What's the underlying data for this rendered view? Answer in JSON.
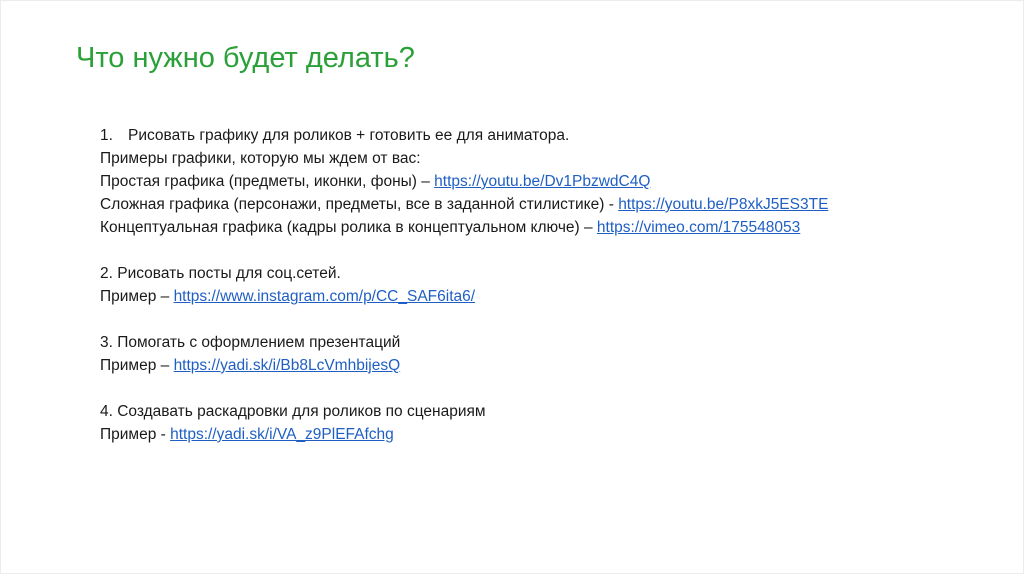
{
  "theme": {
    "title_color": "#2aa038",
    "link_color": "#1f5fc4"
  },
  "title": "Что нужно будет делать?",
  "items": [
    {
      "heading_number": "1.",
      "heading_text": "Рисовать графику для роликов + готовить ее для аниматора.",
      "subheading": "Примеры графики, которую мы ждем от вас:",
      "examples": [
        {
          "text": "Простая графика (предметы, иконки, фоны) – ",
          "link": "https://youtu.be/Dv1PbzwdC4Q"
        },
        {
          "text": "Сложная графика (персонажи, предметы, все в заданной стилистике) - ",
          "link": "https://youtu.be/P8xkJ5ES3TE"
        },
        {
          "text": "Концептуальная графика (кадры ролика в концептуальном ключе) – ",
          "link": "https://vimeo.com/175548053"
        }
      ]
    },
    {
      "heading": "2. Рисовать посты для соц.сетей.",
      "example_text": "Пример – ",
      "example_link": "https://www.instagram.com/p/CC_SAF6ita6/"
    },
    {
      "heading": "3. Помогать с оформлением презентаций",
      "example_text": "Пример – ",
      "example_link": "https://yadi.sk/i/Bb8LcVmhbijesQ"
    },
    {
      "heading": "4. Создавать раскадровки для роликов по сценариям",
      "example_text": "Пример - ",
      "example_link": "https://yadi.sk/i/VA_z9PlEFAfchg"
    }
  ]
}
